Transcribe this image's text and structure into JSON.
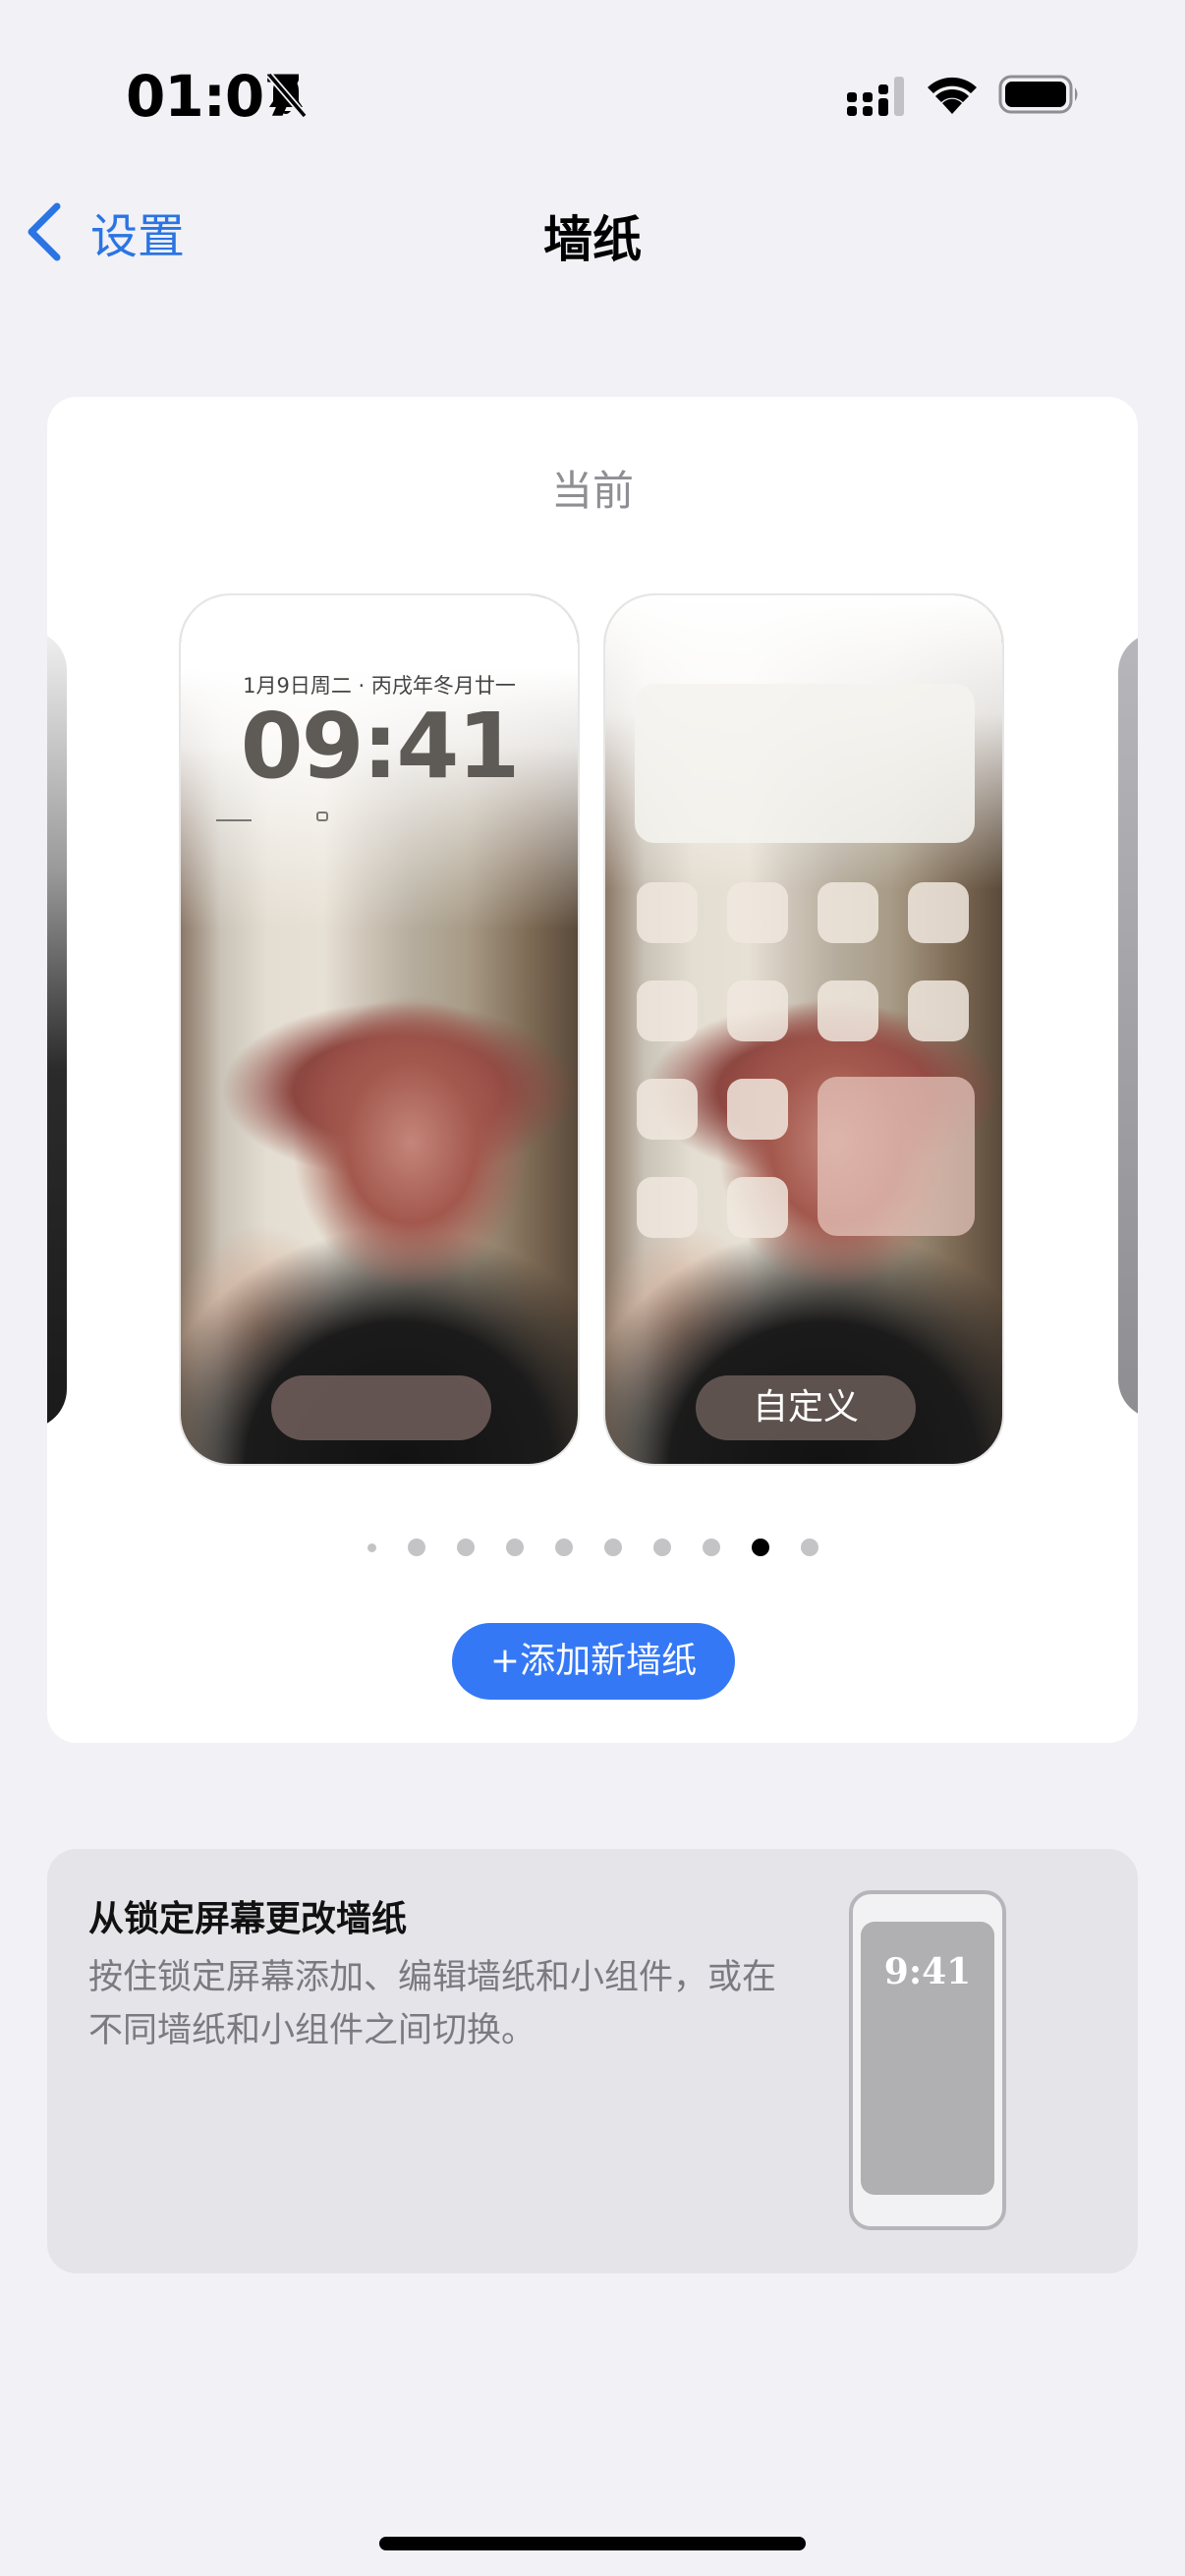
{
  "status_bar": {
    "time": "01:07",
    "icons": [
      "bell-slash-icon",
      "cellular-icon",
      "wifi-icon",
      "battery-icon"
    ]
  },
  "nav": {
    "back_label": "设置",
    "title": "墙纸"
  },
  "wallpaper": {
    "current_label": "当前",
    "lock_screen": {
      "date": "1月9日周二 · 丙戌年冬月廿一",
      "time": "09:41"
    },
    "home_screen": {
      "customize_label": "自定义"
    },
    "page_dots": {
      "count": 10,
      "active_index": 8
    },
    "add_button_label": "+添加新墙纸"
  },
  "info": {
    "title": "从锁定屏幕更改墙纸",
    "body": "按住锁定屏幕添加、编辑墙纸和小组件，或在不同墙纸和小组件之间切换。",
    "preview_time": "9:41"
  },
  "colors": {
    "accent": "#3478f6",
    "link": "#2b74e3",
    "background": "#f1f1f6"
  }
}
